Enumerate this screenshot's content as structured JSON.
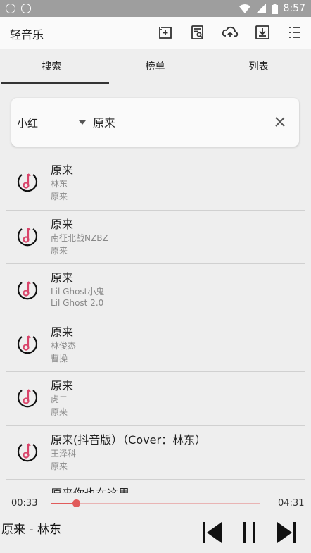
{
  "status_bar": {
    "time": "8:57"
  },
  "app": {
    "title": "轻音乐"
  },
  "toolbar": {
    "icons": [
      "add-playlist-icon",
      "search-doc-icon",
      "cloud-sync-icon",
      "download-icon",
      "menu-list-icon"
    ]
  },
  "tabs": [
    {
      "label": "搜索",
      "active": true
    },
    {
      "label": "榜单",
      "active": false
    },
    {
      "label": "列表",
      "active": false
    }
  ],
  "search": {
    "source": "小红",
    "query": "原来"
  },
  "songs": [
    {
      "title": "原来",
      "artist": "林东",
      "album": "原来"
    },
    {
      "title": "原来",
      "artist": "南征北战NZBZ",
      "album": "原来"
    },
    {
      "title": "原来",
      "artist": "Lil Ghost小鬼",
      "album": "Lil Ghost 2.0"
    },
    {
      "title": "原来",
      "artist": "林俊杰",
      "album": "曹操"
    },
    {
      "title": "原来",
      "artist": "虎二",
      "album": "原来"
    },
    {
      "title": "原来(抖音版）（Cover：林东）",
      "artist": "王泽科",
      "album": "原来"
    },
    {
      "title": "原来你也在这里",
      "artist": "",
      "album": ""
    }
  ],
  "player": {
    "elapsed": "00:33",
    "duration": "04:31",
    "progress": 0.12,
    "now_playing": "原来 - 林东"
  },
  "colors": {
    "accent": "#e15b5b",
    "icon_note": "#d9446a"
  }
}
